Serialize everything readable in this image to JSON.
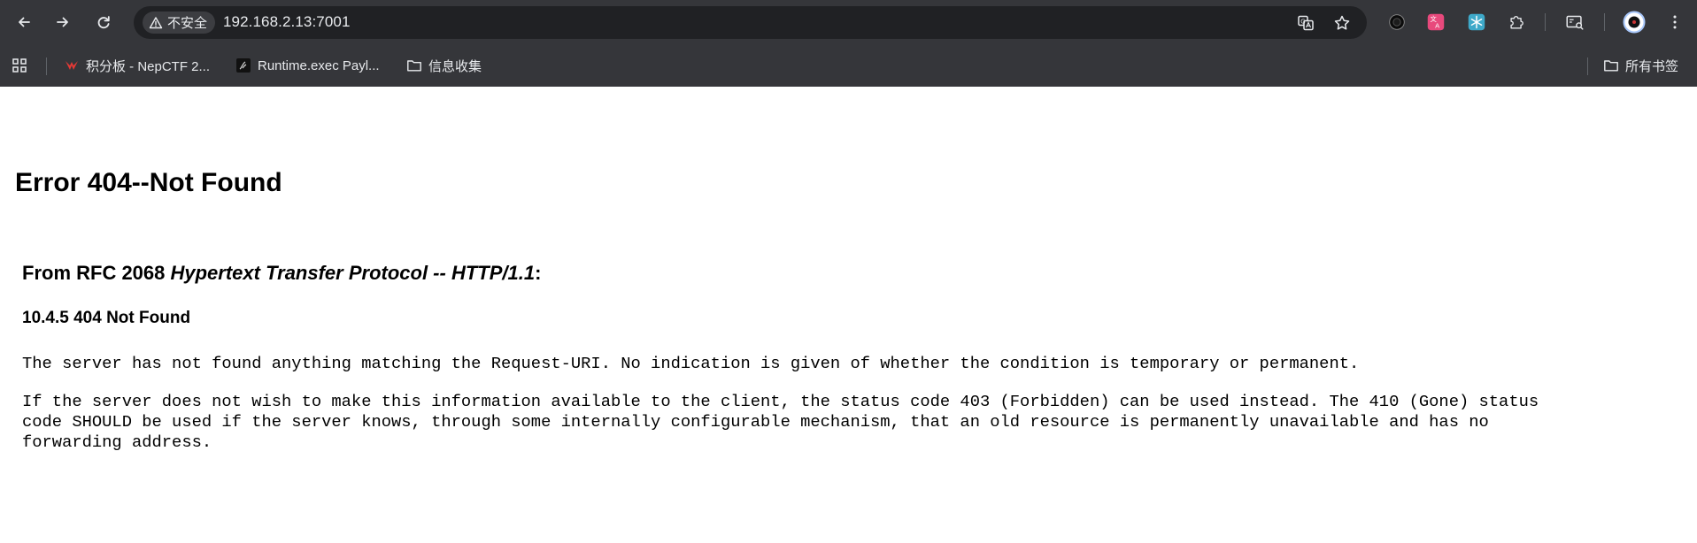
{
  "browser": {
    "security_label": "不安全",
    "url": "192.168.2.13:7001",
    "bookmarks": [
      {
        "label": "积分板 - NepCTF 2...",
        "icon": "ctf-logo-icon"
      },
      {
        "label": "Runtime.exec Payl...",
        "icon": "site-favicon"
      },
      {
        "label": "信息收集",
        "icon": "folder-icon"
      }
    ],
    "all_bookmarks_label": "所有书签",
    "toolbar_icons": [
      "back-icon",
      "forward-icon",
      "reload-icon",
      "translate-icon",
      "star-icon",
      "extension-icon",
      "extensions-puzzle-icon",
      "reading-mode-icon",
      "profile-avatar",
      "menu-icon"
    ]
  },
  "page": {
    "title": "Error 404--Not Found",
    "rfc_prefix": "From RFC 2068 ",
    "rfc_title": "Hypertext Transfer Protocol -- HTTP/1.1",
    "rfc_suffix": ":",
    "section_heading": "10.4.5 404 Not Found",
    "paragraph_1": "The server has not found anything matching the Request-URI. No indication is given of whether the condition is temporary or permanent.",
    "paragraph_2": "If the server does not wish to make this information available to the client, the status code 403 (Forbidden) can be used instead. The 410 (Gone) status\ncode SHOULD be used if the server knows, through some internally configurable mechanism, that an old resource is permanently unavailable and has no\nforwarding address."
  },
  "colors": {
    "chrome_bg": "#35363a",
    "omnibox_bg": "#202124",
    "chrome_text": "#e8eaed",
    "page_bg": "#ffffff",
    "page_text": "#000000"
  }
}
